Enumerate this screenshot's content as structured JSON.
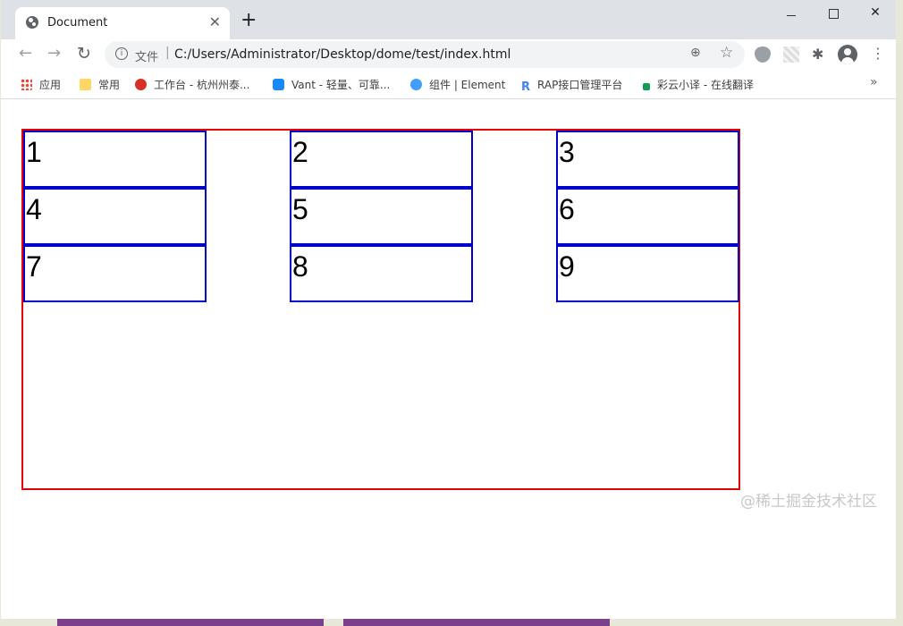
{
  "tab": {
    "title": "Document",
    "close_glyph": "✕",
    "icon": "globe-icon"
  },
  "new_tab_glyph": "+",
  "window_controls": {
    "minimize": "",
    "maximize": "",
    "close": "✕"
  },
  "toolbar": {
    "back_glyph": "←",
    "forward_glyph": "→",
    "reload_glyph": "↻",
    "scheme_label": "文件",
    "separator": "|",
    "url": "C:/Users/Administrator/Desktop/dome/test/index.html",
    "zoom_icon": "⊕",
    "star_glyph": "☆",
    "extension_glyph": "✱",
    "menu_glyph": "⋮"
  },
  "bookmarks": [
    {
      "label": "应用",
      "icon": "apps-icon"
    },
    {
      "label": "常用",
      "icon": "folder-icon"
    },
    {
      "label": "工作台 - 杭州州泰...",
      "icon": "workbench-icon"
    },
    {
      "label": "Vant - 轻量、可靠...",
      "icon": "vant-icon"
    },
    {
      "label": "组件 | Element",
      "icon": "element-icon"
    },
    {
      "label": "RAP接口管理平台",
      "icon": "rap-icon"
    },
    {
      "label": "彩云小译 - 在线翻译",
      "icon": "flag-icon"
    }
  ],
  "bookmarks_more": "»",
  "grid": {
    "cells": [
      "1",
      "2",
      "3",
      "4",
      "5",
      "6",
      "7",
      "8",
      "9"
    ]
  },
  "colors": {
    "container_border": "#e60000",
    "cell_border": "#0000cc"
  },
  "watermark": "@稀土掘金技术社区"
}
